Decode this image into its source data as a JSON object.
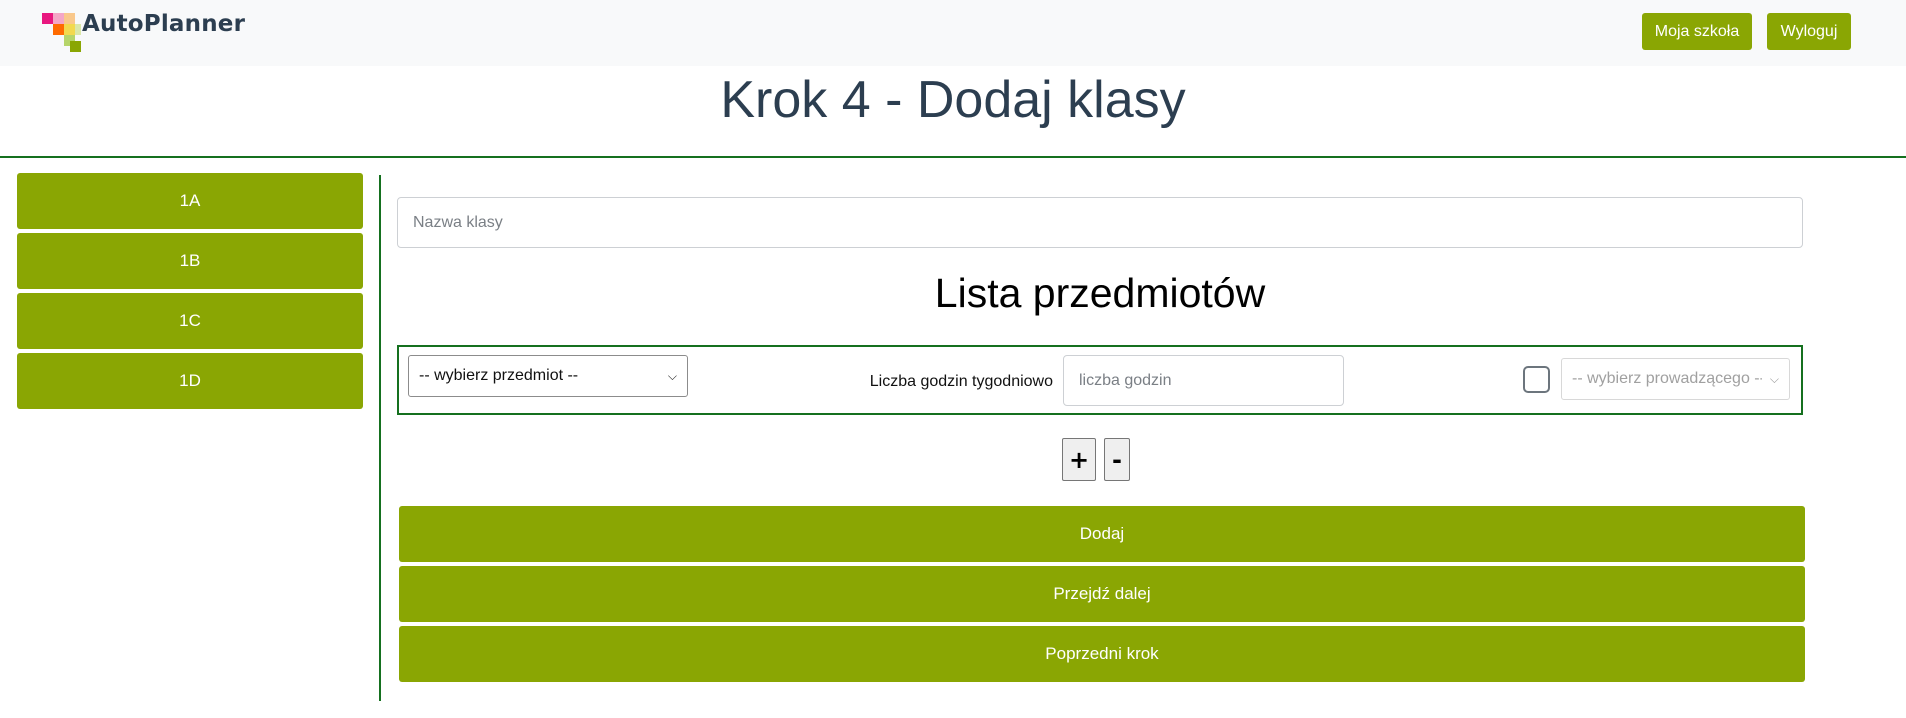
{
  "navbar": {
    "logo_text": "AutoPlanner",
    "logo_colors": [
      "#e8177f",
      "#f4a6c6",
      "#ff6a00",
      "#f9c88b",
      "#f2d94e",
      "#b6d56a",
      "#8aa603",
      "#5a8c00"
    ],
    "my_school_label": "Moja szkoła",
    "logout_label": "Wyloguj"
  },
  "page": {
    "title": "Krok 4 - Dodaj klasy"
  },
  "sidebar": {
    "items": [
      {
        "label": "1A"
      },
      {
        "label": "1B"
      },
      {
        "label": "1C"
      },
      {
        "label": "1D"
      }
    ]
  },
  "form": {
    "class_name_placeholder": "Nazwa klasy",
    "subjects_heading": "Lista przedmiotów",
    "subject_row": {
      "subject_select_value": "-- wybierz przedmiot --",
      "hours_label": "Liczba godzin tygodniowo",
      "hours_placeholder": "liczba godzin",
      "teacher_checkbox_checked": false,
      "teacher_select_value": "-- wybierz prowadzącego --"
    },
    "add_row_label": "+",
    "remove_row_label": "-",
    "add_button_label": "Dodaj",
    "next_button_label": "Przejdź dalej",
    "prev_button_label": "Poprzedni krok"
  },
  "colors": {
    "accent": "#8aa603",
    "rule": "#15701f",
    "title_text": "#2c3e50"
  }
}
